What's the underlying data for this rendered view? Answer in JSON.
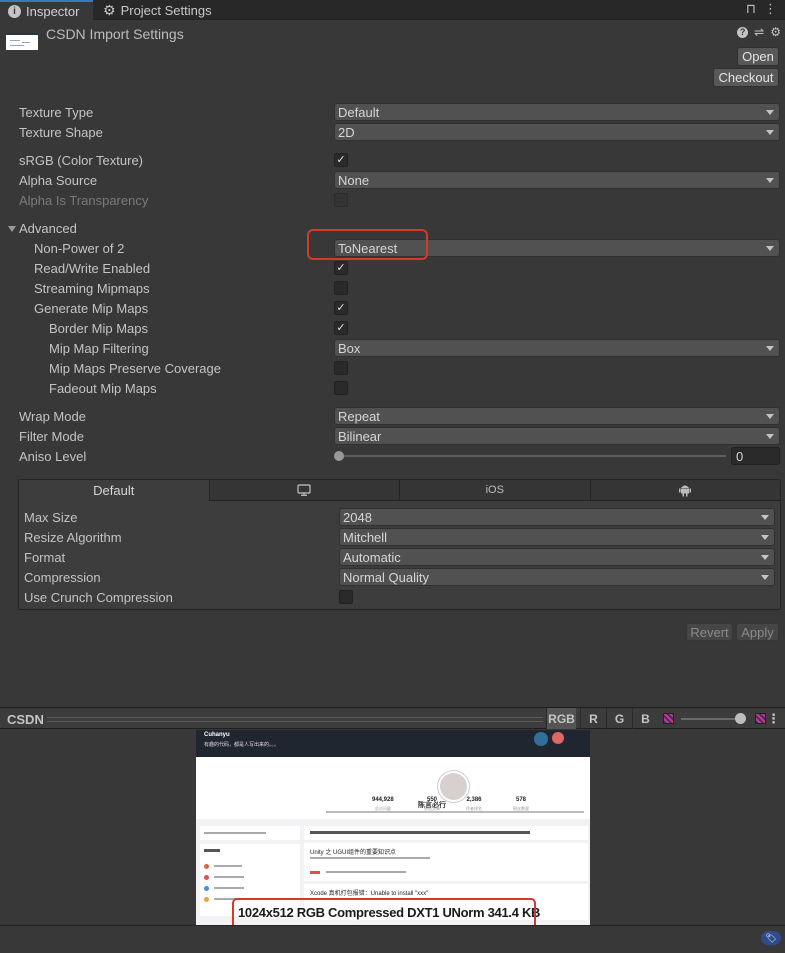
{
  "tabs": [
    {
      "label": "Inspector",
      "icon": "info-icon",
      "active": true
    },
    {
      "label": "Project Settings",
      "icon": "gear-icon",
      "active": false
    }
  ],
  "tabbar_icons": {
    "lock": "🔓",
    "menu": "⋮"
  },
  "header": {
    "title": "CSDN Import Settings",
    "open_label": "Open",
    "checkout_label": "Checkout",
    "help_glyph": "?",
    "presets_glyph": "⇌",
    "settings_glyph": "⚙"
  },
  "properties": {
    "texture_type": {
      "label": "Texture Type",
      "value": "Default"
    },
    "texture_shape": {
      "label": "Texture Shape",
      "value": "2D"
    },
    "srgb": {
      "label": "sRGB (Color Texture)",
      "checked": true
    },
    "alpha_source": {
      "label": "Alpha Source",
      "value": "None"
    },
    "alpha_is_transparency": {
      "label": "Alpha Is Transparency",
      "checked": false,
      "disabled": true
    },
    "advanced": {
      "label": "Advanced",
      "expanded": true
    },
    "non_power_of_2": {
      "label": "Non-Power of 2",
      "value": "ToNearest"
    },
    "read_write": {
      "label": "Read/Write Enabled",
      "checked": true
    },
    "streaming_mipmaps": {
      "label": "Streaming Mipmaps",
      "checked": false
    },
    "generate_mip_maps": {
      "label": "Generate Mip Maps",
      "checked": true
    },
    "border_mip_maps": {
      "label": "Border Mip Maps",
      "checked": true
    },
    "mip_map_filtering": {
      "label": "Mip Map Filtering",
      "value": "Box"
    },
    "mip_maps_preserve_coverage": {
      "label": "Mip Maps Preserve Coverage",
      "checked": false
    },
    "fadeout_mip_maps": {
      "label": "Fadeout Mip Maps",
      "checked": false
    },
    "wrap_mode": {
      "label": "Wrap Mode",
      "value": "Repeat"
    },
    "filter_mode": {
      "label": "Filter Mode",
      "value": "Bilinear"
    },
    "aniso_level": {
      "label": "Aniso Level",
      "value": "0",
      "range": [
        0,
        16
      ]
    }
  },
  "check_glyph": "✓",
  "platform": {
    "tabs": [
      {
        "label": "Default",
        "icon": null,
        "active": true
      },
      {
        "label": "",
        "icon": "monitor-icon",
        "active": false
      },
      {
        "label": "iOS",
        "icon": null,
        "active": false
      },
      {
        "label": "",
        "icon": "android-icon",
        "active": false
      }
    ],
    "max_size": {
      "label": "Max Size",
      "value": "2048"
    },
    "resize_algorithm": {
      "label": "Resize Algorithm",
      "value": "Mitchell"
    },
    "format": {
      "label": "Format",
      "value": "Automatic"
    },
    "compression": {
      "label": "Compression",
      "value": "Normal Quality"
    },
    "use_crunch": {
      "label": "Use Crunch Compression",
      "checked": false
    }
  },
  "actions": {
    "revert_label": "Revert",
    "apply_label": "Apply"
  },
  "preview": {
    "title": "CSDN",
    "channels": [
      {
        "label": "RGB",
        "active": true
      },
      {
        "label": "R",
        "active": false
      },
      {
        "label": "G",
        "active": false
      },
      {
        "label": "B",
        "active": false
      }
    ],
    "mip_level": 1.0,
    "menu_glyph": "⋮",
    "image": {
      "banner_name": "Cuhanyu",
      "banner_sub": "有趣的代码，都是人写出来的。。。",
      "profile_name": "陈言必行",
      "stats": [
        {
          "value": "944,928",
          "label": "总访问量"
        },
        {
          "value": "550",
          "label": "原创文章"
        },
        {
          "value": "2,386",
          "label": "作者排名"
        },
        {
          "value": "578",
          "label": "粉丝数量"
        }
      ],
      "article_1_title": "Unity 之 UGUI组件的重要知识点",
      "article_2_title": "Xcode 真机打包报错：Unable to install \"xxx\""
    },
    "info": "1024x512  RGB Compressed DXT1 UNorm   341.4 KB"
  },
  "accent_colors": {
    "tab_highlight": "#3a79bb",
    "annotation_red": "#d03b2a",
    "asset_label": "#2e4b8a"
  }
}
